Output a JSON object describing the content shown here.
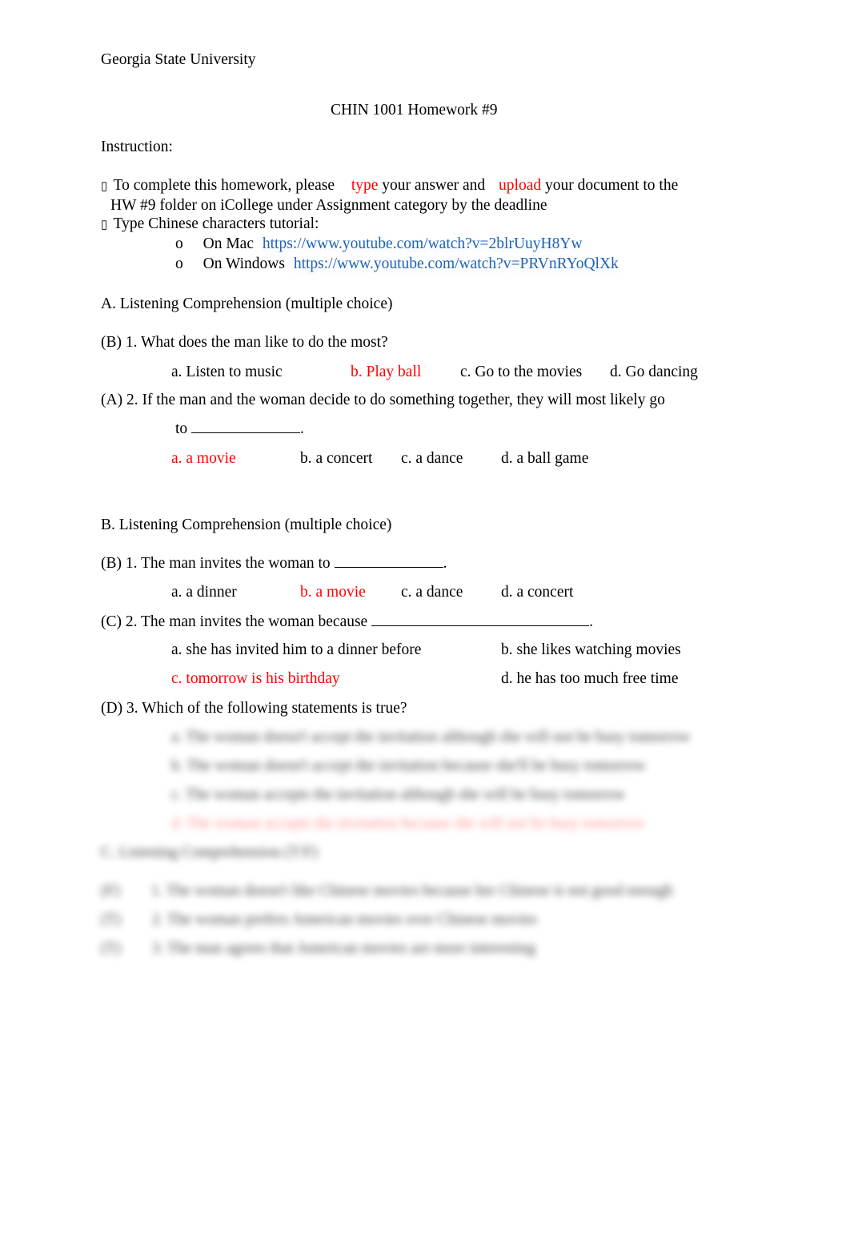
{
  "header": {
    "institution": "Georgia State University",
    "title": "CHIN 1001 Homework #9",
    "instruction_label": "Instruction:"
  },
  "instructions": {
    "bullet_glyph": "▯",
    "line1_part1": "To complete this homework, please",
    "line1_highlight1": "type",
    "line1_part2": "your answer and",
    "line1_highlight2": "upload",
    "line1_part3": "your document to the",
    "line2": "HW #9 folder on iCollege under Assignment category by the deadline",
    "line3": "Type Chinese characters tutorial:",
    "sub_bullet": "o",
    "tutorials": [
      {
        "label": "On Mac",
        "url": "https://www.youtube.com/watch?v=2blrUuyH8Yw"
      },
      {
        "label": "On Windows",
        "url": "https://www.youtube.com/watch?v=PRVnRYoQlXk"
      }
    ]
  },
  "sectionA": {
    "heading": "A. Listening Comprehension (multiple choice)",
    "q1": {
      "text": "(B) 1. What does the man like to do the most?",
      "options": [
        "a. Listen to music",
        "b. Play ball",
        "c. Go to the movies",
        "d. Go dancing"
      ],
      "correct_index": 1
    },
    "q2": {
      "text": "(A) 2. If the man and the woman decide to do something together, they will most likely go",
      "continuation": "to",
      "blank_end": ".",
      "options": [
        "a. a movie",
        "b. a concert",
        "c. a dance",
        "d. a ball game"
      ],
      "correct_index": 0
    }
  },
  "sectionB": {
    "heading": "B. Listening Comprehension (multiple choice)",
    "q1": {
      "text": "(B) 1. The man invites the woman to",
      "blank_end": ".",
      "options": [
        "a. a dinner",
        "b. a movie",
        "c. a dance",
        "d. a concert"
      ],
      "correct_index": 1
    },
    "q2": {
      "text": "(C) 2. The man invites the woman because",
      "blank_end": ".",
      "options": [
        "a. she has invited him to a dinner before",
        "b. she likes watching movies",
        "c. tomorrow is his birthday",
        "d. he has too much free time"
      ],
      "correct_index": 2
    },
    "q3": {
      "text": "(D) 3. Which of the following statements is true?",
      "options": [
        "a. The woman doesn't accept the invitation although she will not be busy tomorrow",
        "b. The woman doesn't accept the invitation because she'll be busy tomorrow",
        "c. The woman accepts the invitation although she will be busy tomorrow",
        "d. The woman accepts the invitation because she will not be busy tomorrow"
      ],
      "correct_index": 3
    }
  },
  "sectionC": {
    "heading": "C. Listening Comprehension (T/F)",
    "items": [
      {
        "answer": "(F)",
        "text": "1. The woman doesn't like Chinese movies because her Chinese is not good enough"
      },
      {
        "answer": "(T)",
        "text": "2. The woman prefers American movies over Chinese movies"
      },
      {
        "answer": "(T)",
        "text": "3. The man agrees that American movies are more interesting"
      }
    ]
  },
  "colors": {
    "answer_red": "#ff0000",
    "link_blue": "#1f63b5"
  }
}
